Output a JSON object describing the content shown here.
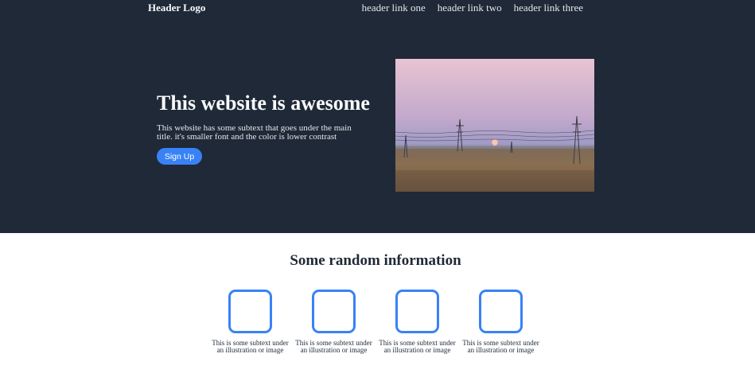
{
  "header": {
    "logo": "Header Logo",
    "links": [
      "header link one",
      "header link two",
      "header link three"
    ]
  },
  "hero": {
    "title": "This website is awesome",
    "subtitle": "This website has some subtext that goes under the main title. it's smaller font and the color is lower contrast",
    "cta_label": "Sign Up",
    "image_alt": "landscape-with-power-lines"
  },
  "info": {
    "title": "Some random information",
    "cards": [
      {
        "text": "This is some subtext under an illustration or image"
      },
      {
        "text": "This is some subtext under an illustration or image"
      },
      {
        "text": "This is some subtext under an illustration or image"
      },
      {
        "text": "This is some subtext under an illustration or image"
      }
    ]
  },
  "colors": {
    "hero_bg": "#1f2937",
    "accent": "#3882f6",
    "page_bg": "#ffffff"
  }
}
